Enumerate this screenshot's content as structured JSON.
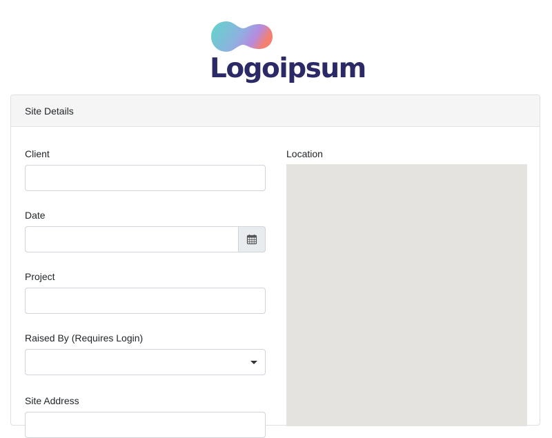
{
  "logo": {
    "text": "Logoipsum",
    "gradient": [
      "#5fd3c8",
      "#9b8fe0",
      "#f07c8a"
    ],
    "text_color": "#2b2a66"
  },
  "card": {
    "title": "Site Details"
  },
  "form": {
    "client_label": "Client",
    "client_value": "",
    "date_label": "Date",
    "date_value": "",
    "date_icon": "calendar-icon",
    "project_label": "Project",
    "project_value": "",
    "raised_by_label": "Raised By (Requires Login)",
    "raised_by_value": "",
    "site_address_label": "Site Address",
    "location_label": "Location"
  },
  "colors": {
    "border": "#ced4da",
    "addon_bg": "#e9ecef",
    "header_bg": "#f5f5f5",
    "map_bg": "#e5e3df"
  }
}
